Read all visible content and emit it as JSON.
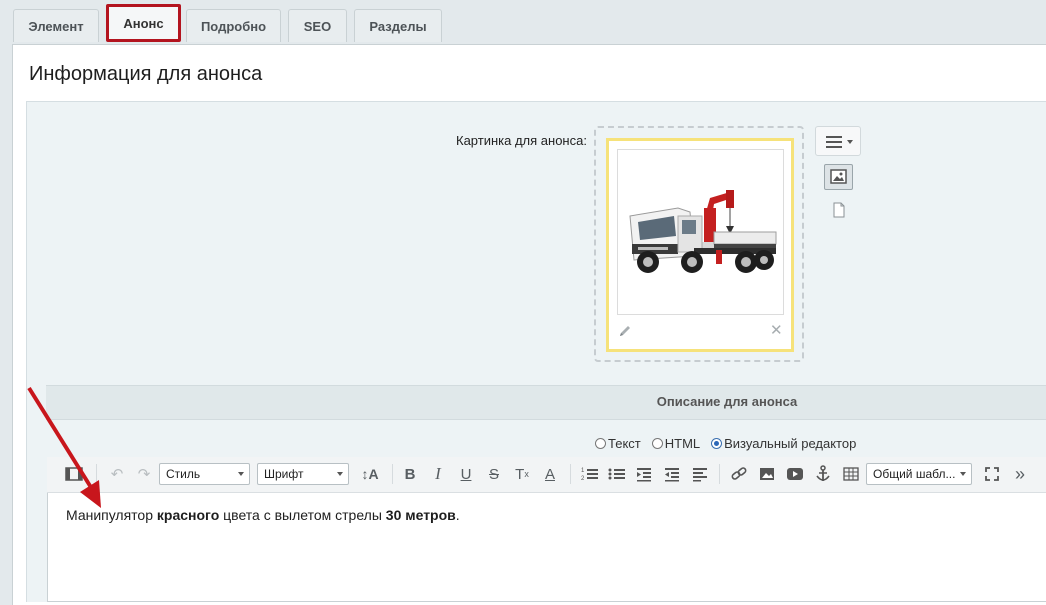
{
  "tabs": [
    {
      "label": "Элемент"
    },
    {
      "label": "Анонс"
    },
    {
      "label": "Подробно"
    },
    {
      "label": "SEO"
    },
    {
      "label": "Разделы"
    }
  ],
  "section": {
    "title": "Информация для анонса"
  },
  "picture": {
    "label": "Картинка для анонса:",
    "image_alt": "truck with crane (manipulator)"
  },
  "description": {
    "title": "Описание для анонса",
    "modes": [
      {
        "label": "Текст",
        "selected": false
      },
      {
        "label": "HTML",
        "selected": false
      },
      {
        "label": "Визуальный редактор",
        "selected": true
      }
    ]
  },
  "toolbar": {
    "style_select": "Стиль",
    "font_select": "Шрифт",
    "template_select": "Общий шабл..."
  },
  "editor": {
    "text_1": "Манипулятор ",
    "text_bold_1": "красного",
    "text_2": " цвета с вылетом стрелы ",
    "text_bold_2": "30 метров",
    "text_3": "."
  },
  "colors": {
    "active_tab_border": "#b3141f",
    "image_frame": "#f6e27a",
    "annotation_arrow": "#c8161c"
  }
}
